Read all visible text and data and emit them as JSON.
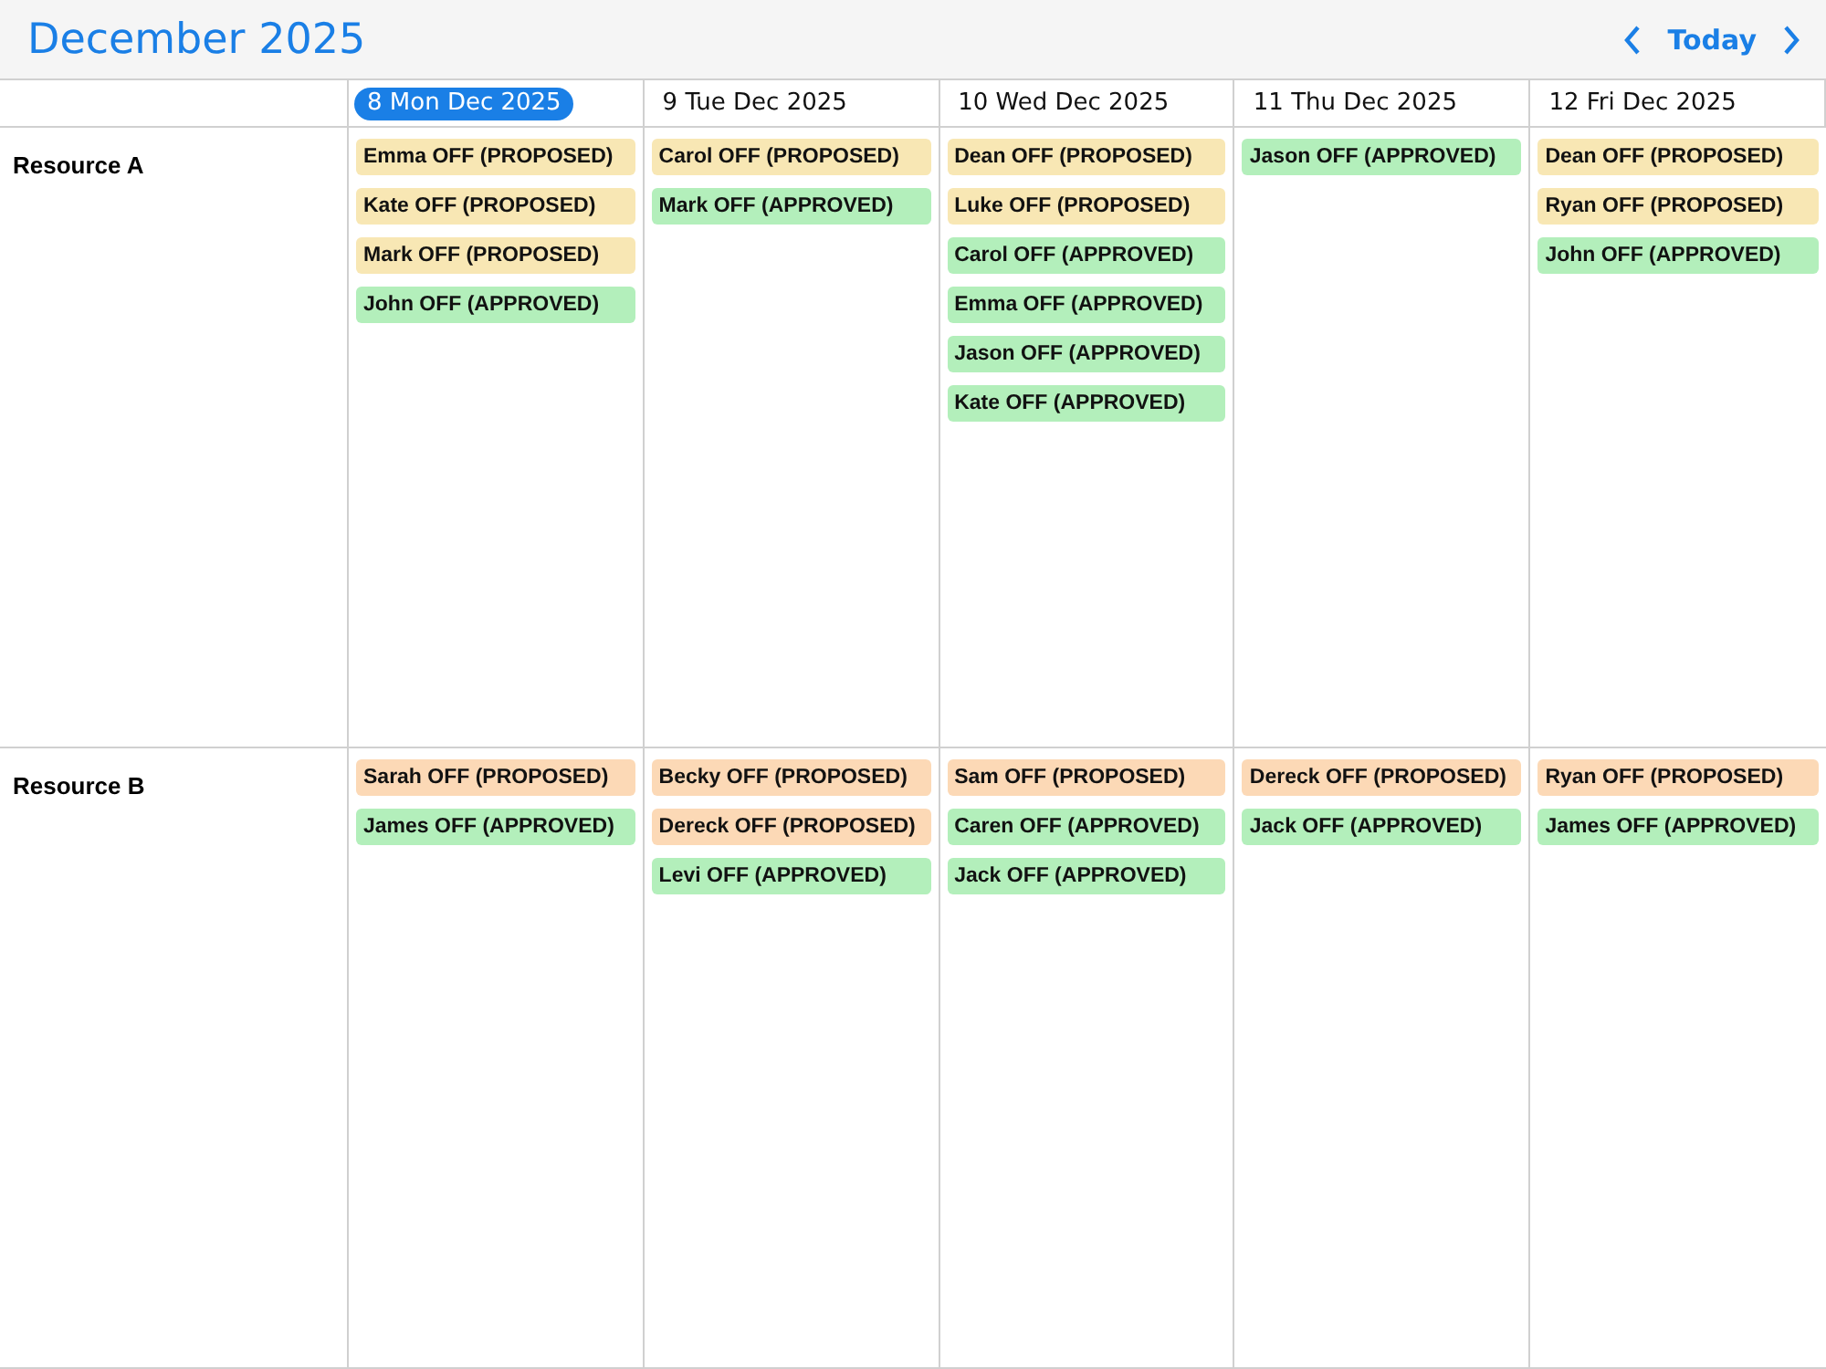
{
  "toolbar": {
    "title": "December 2025",
    "today_label": "Today"
  },
  "days": [
    {
      "label": "8 Mon Dec 2025",
      "selected": true
    },
    {
      "label": "9 Tue Dec 2025",
      "selected": false
    },
    {
      "label": "10 Wed Dec 2025",
      "selected": false
    },
    {
      "label": "11 Thu Dec 2025",
      "selected": false
    },
    {
      "label": "12 Fri Dec 2025",
      "selected": false
    }
  ],
  "resources": [
    {
      "name": "Resource A",
      "cells": [
        [
          {
            "label": "Emma OFF (PROPOSED)",
            "color": "#f8e7b4"
          },
          {
            "label": "Kate OFF (PROPOSED)",
            "color": "#f8e7b4"
          },
          {
            "label": "Mark OFF (PROPOSED)",
            "color": "#f8e7b4"
          },
          {
            "label": "John OFF (APPROVED)",
            "color": "#b3efbb"
          }
        ],
        [
          {
            "label": "Carol OFF (PROPOSED)",
            "color": "#f8e7b4"
          },
          {
            "label": "Mark OFF (APPROVED)",
            "color": "#b3efbb"
          }
        ],
        [
          {
            "label": "Dean OFF (PROPOSED)",
            "color": "#f8e7b4"
          },
          {
            "label": "Luke OFF (PROPOSED)",
            "color": "#f8e7b4"
          },
          {
            "label": "Carol OFF (APPROVED)",
            "color": "#b3efbb"
          },
          {
            "label": "Emma OFF (APPROVED)",
            "color": "#b3efbb"
          },
          {
            "label": "Jason OFF (APPROVED)",
            "color": "#b3efbb"
          },
          {
            "label": "Kate OFF (APPROVED)",
            "color": "#b3efbb"
          }
        ],
        [
          {
            "label": "Jason OFF (APPROVED)",
            "color": "#b3efbb"
          }
        ],
        [
          {
            "label": "Dean OFF (PROPOSED)",
            "color": "#f8e7b4"
          },
          {
            "label": "Ryan OFF (PROPOSED)",
            "color": "#f8e7b4"
          },
          {
            "label": "John OFF (APPROVED)",
            "color": "#b3efbb"
          }
        ]
      ]
    },
    {
      "name": "Resource B",
      "cells": [
        [
          {
            "label": "Sarah OFF (PROPOSED)",
            "color": "#fcd9b6"
          },
          {
            "label": "James OFF (APPROVED)",
            "color": "#b3efbb"
          }
        ],
        [
          {
            "label": "Becky OFF (PROPOSED)",
            "color": "#fcd9b6"
          },
          {
            "label": "Dereck OFF (PROPOSED)",
            "color": "#fcd9b6"
          },
          {
            "label": "Levi OFF (APPROVED)",
            "color": "#b3efbb"
          }
        ],
        [
          {
            "label": "Sam OFF (PROPOSED)",
            "color": "#fcd9b6"
          },
          {
            "label": "Caren OFF (APPROVED)",
            "color": "#b3efbb"
          },
          {
            "label": "Jack OFF (APPROVED)",
            "color": "#b3efbb"
          }
        ],
        [
          {
            "label": "Dereck OFF (PROPOSED)",
            "color": "#fcd9b6"
          },
          {
            "label": "Jack OFF (APPROVED)",
            "color": "#b3efbb"
          }
        ],
        [
          {
            "label": "Ryan OFF (PROPOSED)",
            "color": "#fcd9b6"
          },
          {
            "label": "James OFF (APPROVED)",
            "color": "#b3efbb"
          }
        ]
      ]
    }
  ]
}
